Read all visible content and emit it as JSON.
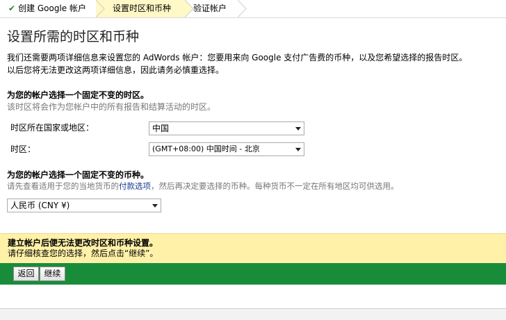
{
  "steps": [
    {
      "label": "创建 Google 帐户",
      "done": true
    },
    {
      "label": "设置时区和币种",
      "current": true
    },
    {
      "label": "验证帐户"
    }
  ],
  "page_title": "设置所需的时区和币种",
  "intro": {
    "line1": "我们还需要两项详细信息来设置您的 AdWords 帐户：您要用来向 Google 支付广告费的币种，以及您希望选择的报告时区。",
    "line2": "以后您将无法更改这两项详细信息，因此请务必慎重选择。"
  },
  "timezone_section": {
    "title": "为您的帐户选择一个固定不变的时区。",
    "desc": "该时区将会作为您帐户中的所有报告和结算活动的时区。",
    "country_label": "时区所在国家或地区：",
    "country_value": "中国",
    "tz_label": "时区：",
    "tz_value": "(GMT+08:00) 中国时间 - 北京"
  },
  "currency_section": {
    "title": "为您的帐户选择一个固定不变的币种。",
    "desc_before": "请先查看适用于您的当地货币的",
    "desc_link": "付款选项",
    "desc_after": "，然后再决定要选择的币种。每种货币不一定在所有地区均可供选用。",
    "currency_value": "人民币 (CNY ¥)"
  },
  "notice": {
    "title": "建立帐户后便无法更改时区和币种设置。",
    "text": "请仔细核查您的选择，然后点击“继续”。"
  },
  "buttons": {
    "back": "返回",
    "continue": "继续"
  },
  "colors": {
    "current_step_bg": "#fff8c7",
    "notice_bg": "#fff1a8",
    "action_bar": "#198c3a",
    "link": "#1a3d8f"
  }
}
